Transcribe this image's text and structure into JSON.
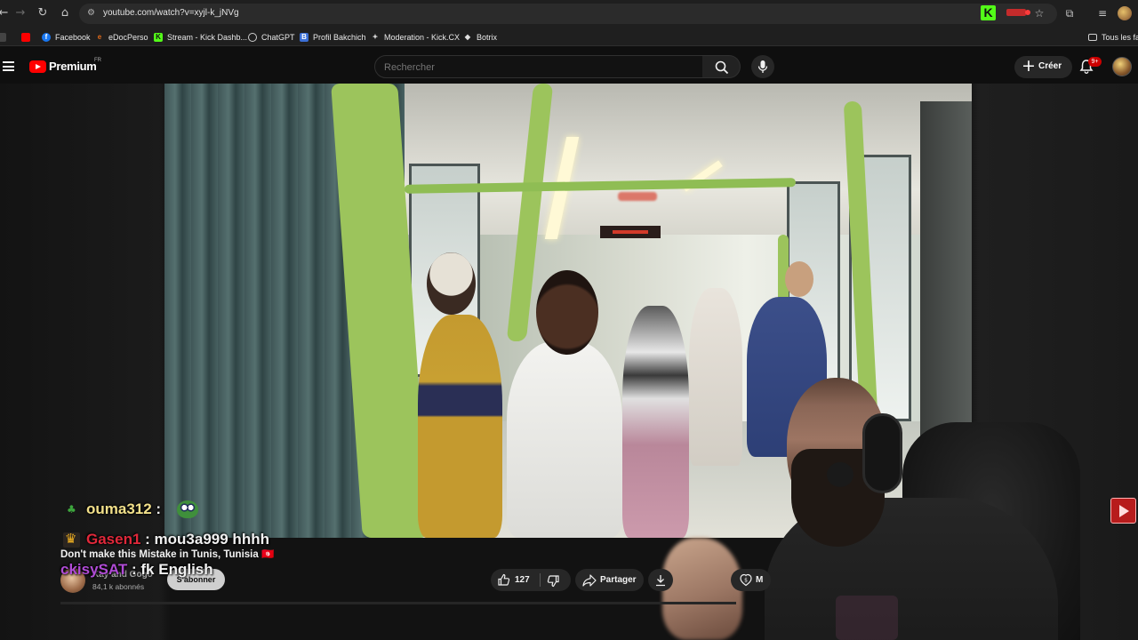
{
  "browser": {
    "url": "youtube.com/watch?v=xyjl-k_jNVg",
    "bookmarks": [
      {
        "label": "",
        "icon": "youtube-icon",
        "color": "#ff0000"
      },
      {
        "label": "Facebook",
        "icon": "facebook-icon",
        "color": "#1877f2"
      },
      {
        "label": "eDocPerso",
        "icon": "edocperso-icon",
        "color": "#e06a1b"
      },
      {
        "label": "Stream - Kick Dashb...",
        "icon": "kick-icon",
        "color": "#53fc18"
      },
      {
        "label": "ChatGPT",
        "icon": "chatgpt-icon",
        "color": "#cfcfcf"
      },
      {
        "label": "Profil Bakchich",
        "icon": "bakchich-icon",
        "color": "#3b6fd6"
      },
      {
        "label": "Moderation - Kick.CX",
        "icon": "moderation-icon",
        "color": "#cfcfcf"
      },
      {
        "label": "Botrix",
        "icon": "botrix-icon",
        "color": "#e0e0e0"
      }
    ],
    "all_bookmarks": "Tous les fav"
  },
  "youtube": {
    "logo_text": "Premium",
    "region": "FR",
    "search_placeholder": "Rechercher",
    "create_label": "Créer",
    "notification_count": "9+"
  },
  "video": {
    "title": "Don't make this Mistake in Tunis, Tunisia 🇹🇳",
    "title_flag": "TN",
    "channel_name": "Kay and Gogo",
    "subscribers": "84,1 k abonnés",
    "subscribe_label": "S'abonner",
    "likes": "127",
    "share_label": "Partager",
    "thanks_label": "M"
  },
  "chat": [
    {
      "user": "ouma312",
      "separator": " :",
      "message": "",
      "user_color": "#f2e08a"
    },
    {
      "user": "Gasen1",
      "separator": " :",
      "message": " mou3a999 hhhh",
      "user_color": "#e0283a"
    },
    {
      "user": "ckisySAT",
      "separator": " :",
      "message": " fk English",
      "user_color": "#b04bd6"
    }
  ],
  "colors": {
    "accent": "#ff0000",
    "kick_green": "#53fc18",
    "badge_red": "#cc0000"
  }
}
